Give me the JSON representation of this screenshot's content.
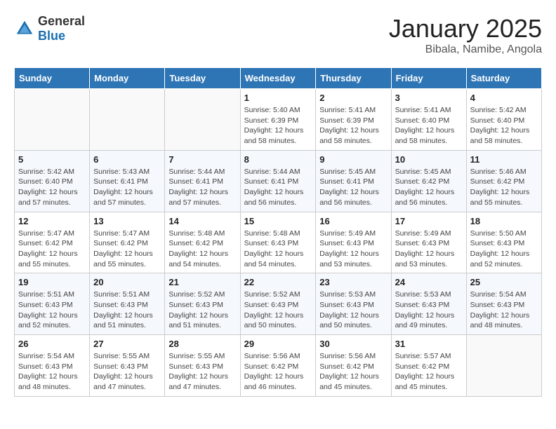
{
  "logo": {
    "text_general": "General",
    "text_blue": "Blue"
  },
  "header": {
    "title": "January 2025",
    "subtitle": "Bibala, Namibe, Angola"
  },
  "weekdays": [
    "Sunday",
    "Monday",
    "Tuesday",
    "Wednesday",
    "Thursday",
    "Friday",
    "Saturday"
  ],
  "weeks": [
    [
      {
        "day": "",
        "info": ""
      },
      {
        "day": "",
        "info": ""
      },
      {
        "day": "",
        "info": ""
      },
      {
        "day": "1",
        "info": "Sunrise: 5:40 AM\nSunset: 6:39 PM\nDaylight: 12 hours\nand 58 minutes."
      },
      {
        "day": "2",
        "info": "Sunrise: 5:41 AM\nSunset: 6:39 PM\nDaylight: 12 hours\nand 58 minutes."
      },
      {
        "day": "3",
        "info": "Sunrise: 5:41 AM\nSunset: 6:40 PM\nDaylight: 12 hours\nand 58 minutes."
      },
      {
        "day": "4",
        "info": "Sunrise: 5:42 AM\nSunset: 6:40 PM\nDaylight: 12 hours\nand 58 minutes."
      }
    ],
    [
      {
        "day": "5",
        "info": "Sunrise: 5:42 AM\nSunset: 6:40 PM\nDaylight: 12 hours\nand 57 minutes."
      },
      {
        "day": "6",
        "info": "Sunrise: 5:43 AM\nSunset: 6:41 PM\nDaylight: 12 hours\nand 57 minutes."
      },
      {
        "day": "7",
        "info": "Sunrise: 5:44 AM\nSunset: 6:41 PM\nDaylight: 12 hours\nand 57 minutes."
      },
      {
        "day": "8",
        "info": "Sunrise: 5:44 AM\nSunset: 6:41 PM\nDaylight: 12 hours\nand 56 minutes."
      },
      {
        "day": "9",
        "info": "Sunrise: 5:45 AM\nSunset: 6:41 PM\nDaylight: 12 hours\nand 56 minutes."
      },
      {
        "day": "10",
        "info": "Sunrise: 5:45 AM\nSunset: 6:42 PM\nDaylight: 12 hours\nand 56 minutes."
      },
      {
        "day": "11",
        "info": "Sunrise: 5:46 AM\nSunset: 6:42 PM\nDaylight: 12 hours\nand 55 minutes."
      }
    ],
    [
      {
        "day": "12",
        "info": "Sunrise: 5:47 AM\nSunset: 6:42 PM\nDaylight: 12 hours\nand 55 minutes."
      },
      {
        "day": "13",
        "info": "Sunrise: 5:47 AM\nSunset: 6:42 PM\nDaylight: 12 hours\nand 55 minutes."
      },
      {
        "day": "14",
        "info": "Sunrise: 5:48 AM\nSunset: 6:42 PM\nDaylight: 12 hours\nand 54 minutes."
      },
      {
        "day": "15",
        "info": "Sunrise: 5:48 AM\nSunset: 6:43 PM\nDaylight: 12 hours\nand 54 minutes."
      },
      {
        "day": "16",
        "info": "Sunrise: 5:49 AM\nSunset: 6:43 PM\nDaylight: 12 hours\nand 53 minutes."
      },
      {
        "day": "17",
        "info": "Sunrise: 5:49 AM\nSunset: 6:43 PM\nDaylight: 12 hours\nand 53 minutes."
      },
      {
        "day": "18",
        "info": "Sunrise: 5:50 AM\nSunset: 6:43 PM\nDaylight: 12 hours\nand 52 minutes."
      }
    ],
    [
      {
        "day": "19",
        "info": "Sunrise: 5:51 AM\nSunset: 6:43 PM\nDaylight: 12 hours\nand 52 minutes."
      },
      {
        "day": "20",
        "info": "Sunrise: 5:51 AM\nSunset: 6:43 PM\nDaylight: 12 hours\nand 51 minutes."
      },
      {
        "day": "21",
        "info": "Sunrise: 5:52 AM\nSunset: 6:43 PM\nDaylight: 12 hours\nand 51 minutes."
      },
      {
        "day": "22",
        "info": "Sunrise: 5:52 AM\nSunset: 6:43 PM\nDaylight: 12 hours\nand 50 minutes."
      },
      {
        "day": "23",
        "info": "Sunrise: 5:53 AM\nSunset: 6:43 PM\nDaylight: 12 hours\nand 50 minutes."
      },
      {
        "day": "24",
        "info": "Sunrise: 5:53 AM\nSunset: 6:43 PM\nDaylight: 12 hours\nand 49 minutes."
      },
      {
        "day": "25",
        "info": "Sunrise: 5:54 AM\nSunset: 6:43 PM\nDaylight: 12 hours\nand 48 minutes."
      }
    ],
    [
      {
        "day": "26",
        "info": "Sunrise: 5:54 AM\nSunset: 6:43 PM\nDaylight: 12 hours\nand 48 minutes."
      },
      {
        "day": "27",
        "info": "Sunrise: 5:55 AM\nSunset: 6:43 PM\nDaylight: 12 hours\nand 47 minutes."
      },
      {
        "day": "28",
        "info": "Sunrise: 5:55 AM\nSunset: 6:43 PM\nDaylight: 12 hours\nand 47 minutes."
      },
      {
        "day": "29",
        "info": "Sunrise: 5:56 AM\nSunset: 6:42 PM\nDaylight: 12 hours\nand 46 minutes."
      },
      {
        "day": "30",
        "info": "Sunrise: 5:56 AM\nSunset: 6:42 PM\nDaylight: 12 hours\nand 45 minutes."
      },
      {
        "day": "31",
        "info": "Sunrise: 5:57 AM\nSunset: 6:42 PM\nDaylight: 12 hours\nand 45 minutes."
      },
      {
        "day": "",
        "info": ""
      }
    ]
  ]
}
